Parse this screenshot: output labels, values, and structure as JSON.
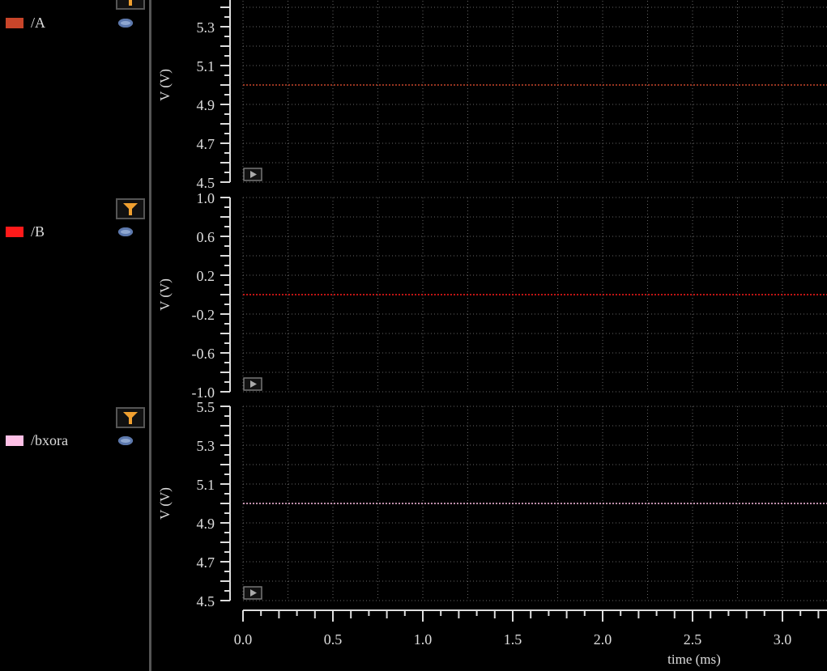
{
  "signals": [
    {
      "name": "/A",
      "color": "#c8452a",
      "value": 5.0,
      "ylim": [
        4.5,
        5.5
      ],
      "ticks": [
        "4.5",
        "4.7",
        "4.9",
        "5.1",
        "5.3"
      ],
      "ylabel": "V (V)"
    },
    {
      "name": "/B",
      "color": "#ff1a1a",
      "value": 0.0,
      "ylim": [
        -1.0,
        1.0
      ],
      "ticks": [
        "-1.0",
        "-0.6",
        "-0.2",
        "0.2",
        "0.6",
        "1.0"
      ],
      "ylabel": "V (V)"
    },
    {
      "name": "/bxora",
      "color": "#ffc0e6",
      "value": 5.0,
      "ylim": [
        4.5,
        5.5
      ],
      "ticks": [
        "4.5",
        "4.7",
        "4.9",
        "5.1",
        "5.3",
        "5.5"
      ],
      "ylabel": "V (V)"
    }
  ],
  "xaxis": {
    "label": "time (ms)",
    "ticks": [
      "0.0",
      "0.5",
      "1.0",
      "1.5",
      "2.0",
      "2.5",
      "3.0"
    ],
    "xlim": [
      0,
      3.25
    ]
  },
  "colors": {
    "grid": "#666666",
    "axis": "#dddddd",
    "filter": "#f0a030",
    "eye": "#8fa7d0"
  }
}
